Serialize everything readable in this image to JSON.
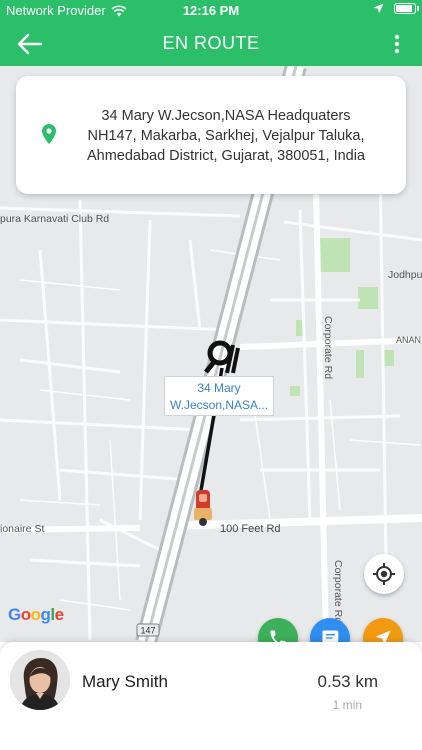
{
  "status_bar": {
    "carrier": "Network Provider",
    "time": "12:16 PM"
  },
  "app_bar": {
    "title": "EN ROUTE"
  },
  "address_card": {
    "line1": "34 Mary W.Jecson,NASA Headquaters",
    "line2": "NH147, Makarba, Sarkhej, Vejalpur Taluka,",
    "line3": "Ahmedabad District, Gujarat, 380051, India"
  },
  "map": {
    "labels": {
      "club_rd": "pura Karnavati Club Rd",
      "jodhpur": "Jodhpu",
      "anand": "ANAN",
      "corporate_rd_1": "Corporate Rd",
      "corporate_rd_2": "Corporate Rd",
      "feet_rd": "100 Feet Rd",
      "millionaire_st": "ionaire St",
      "highway_badge": "147"
    },
    "marker_callout": {
      "line1": "34 Mary",
      "line2": "W.Jecson,NASA..."
    },
    "attribution": "Google"
  },
  "driver": {
    "name": "Mary Smith",
    "distance": "0.53 km",
    "eta": "1 min"
  },
  "colors": {
    "primary": "#2bbf6a",
    "call": "#3db15a",
    "chat": "#2f8ef0",
    "navigate": "#f29b12"
  }
}
